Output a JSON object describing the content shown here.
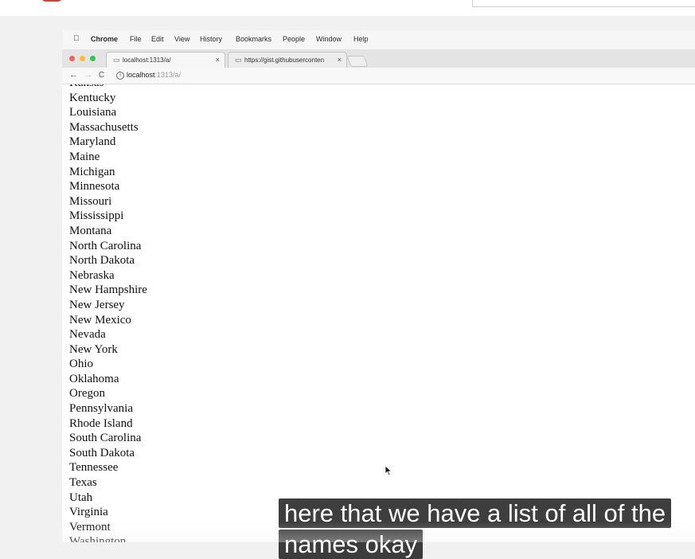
{
  "menubar": {
    "app": "Chrome",
    "items": [
      "File",
      "Edit",
      "View",
      "History",
      "Bookmarks",
      "People",
      "Window",
      "Help"
    ]
  },
  "tabs": [
    {
      "label": "localhost:1313/a/",
      "active": true
    },
    {
      "label": "https://gist.githubuserconten",
      "active": false
    }
  ],
  "addressbar": {
    "host": "localhost",
    "path": ":1313/a/"
  },
  "states": [
    "Kansas",
    "Kentucky",
    "Louisiana",
    "Massachusetts",
    "Maryland",
    "Maine",
    "Michigan",
    "Minnesota",
    "Missouri",
    "Mississippi",
    "Montana",
    "North Carolina",
    "North Dakota",
    "Nebraska",
    "New Hampshire",
    "New Jersey",
    "New Mexico",
    "Nevada",
    "New York",
    "Ohio",
    "Oklahoma",
    "Oregon",
    "Pennsylvania",
    "Rhode Island",
    "South Carolina",
    "South Dakota",
    "Tennessee",
    "Texas",
    "Utah",
    "Virginia",
    "Vermont",
    "Washington"
  ],
  "caption": {
    "line1": "here that we have a list of all of the",
    "line2": "names okay"
  },
  "colors": {
    "traffic_red": "#fc5f57",
    "traffic_yellow": "#fdbc2e",
    "traffic_green": "#33c748",
    "youtube_red": "#e53935"
  }
}
